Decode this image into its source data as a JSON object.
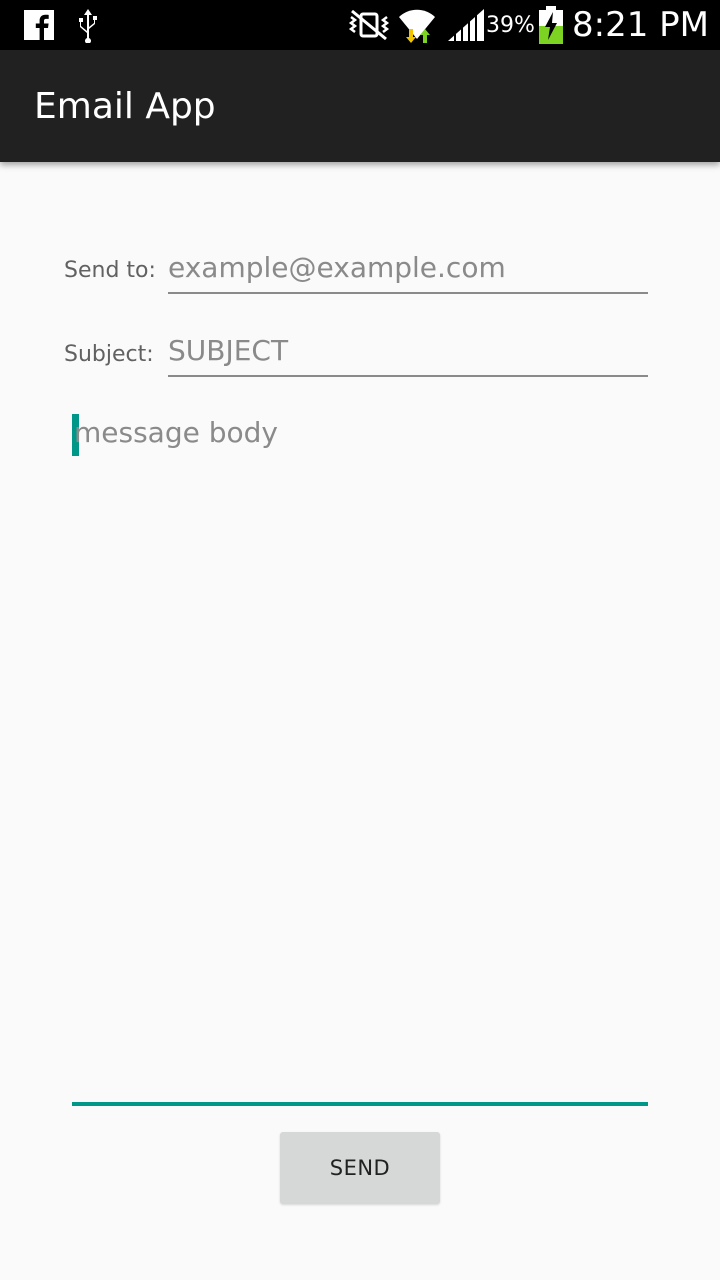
{
  "status_bar": {
    "icons_left": [
      "facebook-icon",
      "usb-icon"
    ],
    "icons_right": [
      "mute-vibrate-icon",
      "wifi-icon",
      "signal-icon",
      "battery-charging-icon"
    ],
    "battery": "39%",
    "time": "8:21 PM"
  },
  "app_bar": {
    "title": "Email App"
  },
  "form": {
    "to_label": "Send to:",
    "to_placeholder": "example@example.com",
    "subject_label": "Subject:",
    "subject_placeholder": "SUBJECT",
    "body_placeholder": "message body",
    "send_label": "SEND"
  },
  "colors": {
    "accent": "#009688",
    "app_bar": "#212121",
    "status_bar": "#000000",
    "background": "#fafafa",
    "button": "#d6d7d7"
  }
}
